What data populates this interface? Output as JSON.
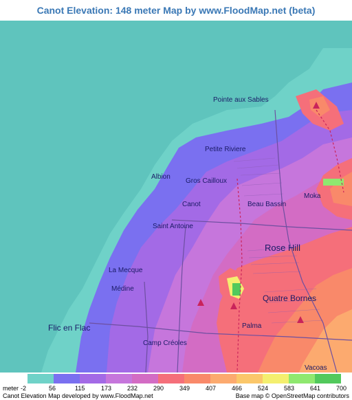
{
  "title": "Canot Elevation: 148 meter Map by www.FloodMap.net (beta)",
  "places": {
    "pointe_aux_sables": "Pointe aux Sables",
    "petite_riviere": "Petite Riviere",
    "albion": "Albion",
    "gros_cailloux": "Gros Cailloux",
    "canot": "Canot",
    "beau_bassin": "Beau Bassin",
    "moka": "Moka",
    "saint_antoine": "Saint Antoine",
    "rose_hill": "Rose Hill",
    "la_mecque": "La Mecque",
    "medine": "Médine",
    "quatre_bornes": "Quatre Bornes",
    "palma": "Palma",
    "flic_en_flac": "Flic en Flac",
    "camp_creoles": "Camp Créoles",
    "vacoas": "Vacoas"
  },
  "legend": {
    "unit_label": "meter",
    "values": [
      "-2",
      "56",
      "115",
      "173",
      "232",
      "290",
      "349",
      "407",
      "466",
      "524",
      "583",
      "641",
      "700"
    ],
    "colors": [
      "#6fd2c8",
      "#7a70f0",
      "#a36ae6",
      "#c676dc",
      "#d36cc4",
      "#f56f7a",
      "#f9896a",
      "#fcaa6f",
      "#fbc76a",
      "#f4ef6f",
      "#8fe86f",
      "#52c95c"
    ]
  },
  "footer": {
    "left": "Canot Elevation Map developed by www.FloodMap.net",
    "right": "Base map © OpenStreetMap contributors"
  },
  "colors": {
    "sea": "#5fc4bd",
    "coast_low": "#6fd2c8",
    "title_blue": "#3a78b5"
  }
}
